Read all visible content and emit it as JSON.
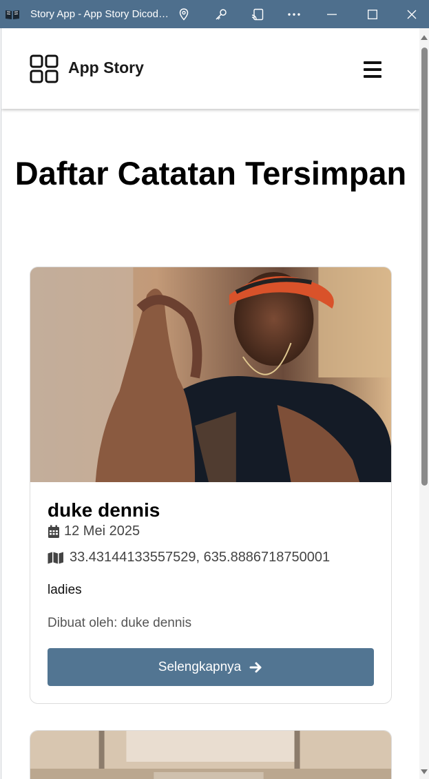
{
  "window": {
    "title": "Story App - App Story Dicoding",
    "icons": [
      "book-icon",
      "location-pin-icon",
      "key-icon",
      "cast-icon",
      "more-icon",
      "minimize-icon",
      "maximize-icon",
      "close-icon"
    ]
  },
  "header": {
    "brand_name": "App Story",
    "brand_icon": "grid-icon",
    "menu_icon": "hamburger-icon"
  },
  "page": {
    "title": "Daftar Catatan Tersimpan"
  },
  "stories": [
    {
      "name": "duke dennis",
      "date": "12 Mei 2025",
      "location": "33.43144133557529, 635.8886718750001",
      "description": "ladies",
      "author": "Dibuat oleh: duke dennis",
      "button_label": "Selengkapnya",
      "date_icon": "calendar-icon",
      "location_icon": "map-icon",
      "button_icon": "arrow-right-icon"
    }
  ],
  "colors": {
    "titlebar": "#4e6f8d",
    "button": "#527592",
    "text_muted": "#555555"
  }
}
